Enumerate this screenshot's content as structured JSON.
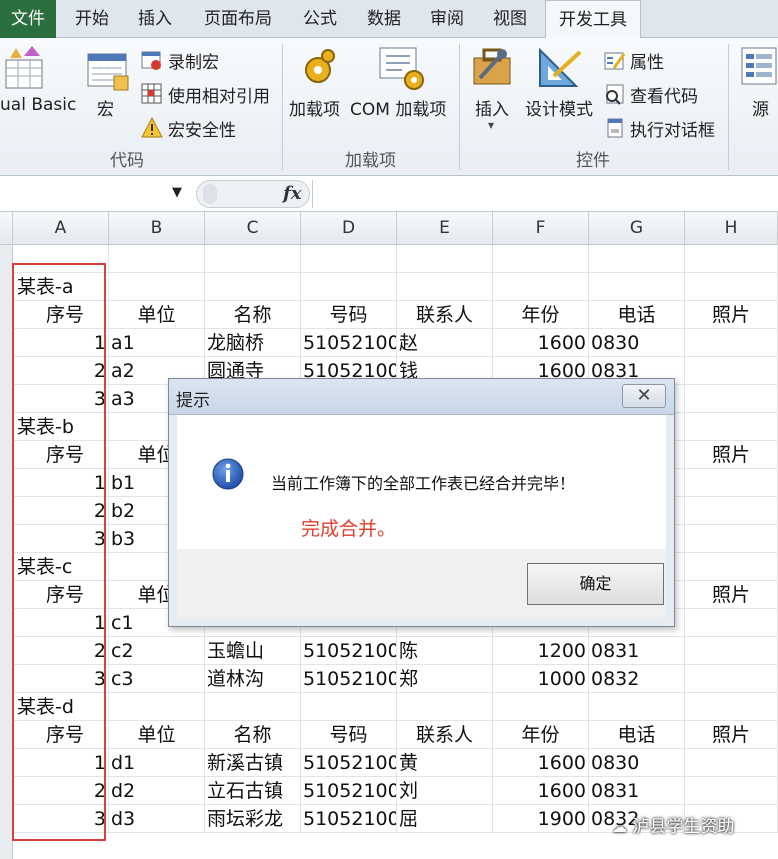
{
  "ribbon": {
    "tabs": [
      "文件",
      "开始",
      "插入",
      "页面布局",
      "公式",
      "数据",
      "审阅",
      "视图",
      "开发工具"
    ],
    "active_tab": "开发工具",
    "code_group": {
      "visual_basic": "ual Basic",
      "macros": "宏",
      "record_macro": "录制宏",
      "use_relative": "使用相对引用",
      "macro_security": "宏安全性",
      "label": "代码"
    },
    "addins_group": {
      "addins": "加载项",
      "com_addins": "COM 加载项",
      "label": "加载项"
    },
    "controls_group": {
      "insert": "插入",
      "design_mode": "设计模式",
      "properties": "属性",
      "view_code": "查看代码",
      "run_dialog": "执行对话框",
      "label": "控件"
    },
    "source": "源"
  },
  "formula_bar": {
    "fx": "fx"
  },
  "grid": {
    "columns": [
      "A",
      "B",
      "C",
      "D",
      "E",
      "F",
      "G",
      "H"
    ],
    "rows": [
      [
        "",
        "",
        "",
        "",
        "",
        "",
        "",
        ""
      ],
      [
        "某表-a",
        "",
        "",
        "",
        "",
        "",
        "",
        ""
      ],
      [
        "序号",
        "单位",
        "名称",
        "号码",
        "联系人",
        "年份",
        "电话",
        "照片"
      ],
      [
        "1",
        "a1",
        "龙脑桥",
        "51052100(",
        "赵",
        "1600",
        "0830",
        ""
      ],
      [
        "2",
        "a2",
        "圆通寺",
        "51052100(",
        "钱",
        "1600",
        "0831",
        ""
      ],
      [
        "3",
        "a3",
        "",
        "",
        "",
        "",
        "",
        ""
      ],
      [
        "某表-b",
        "",
        "",
        "",
        "",
        "",
        "",
        ""
      ],
      [
        "序号",
        "单位",
        "",
        "",
        "",
        "",
        "",
        "照片"
      ],
      [
        "1",
        "b1",
        "",
        "",
        "",
        "",
        "",
        ""
      ],
      [
        "2",
        "b2",
        "",
        "",
        "",
        "",
        "",
        ""
      ],
      [
        "3",
        "b3",
        "",
        "",
        "",
        "",
        "",
        ""
      ],
      [
        "某表-c",
        "",
        "",
        "",
        "",
        "",
        "",
        ""
      ],
      [
        "序号",
        "单位",
        "",
        "",
        "",
        "",
        "",
        "照片"
      ],
      [
        "1",
        "c1",
        "",
        "",
        "",
        "",
        "",
        ""
      ],
      [
        "2",
        "c2",
        "玉蟾山",
        "51052100(",
        "陈",
        "1200",
        "0831",
        ""
      ],
      [
        "3",
        "c3",
        "道林沟",
        "51052100(",
        "郑",
        "1000",
        "0832",
        ""
      ],
      [
        "某表-d",
        "",
        "",
        "",
        "",
        "",
        "",
        ""
      ],
      [
        "序号",
        "单位",
        "名称",
        "号码",
        "联系人",
        "年份",
        "电话",
        "照片"
      ],
      [
        "1",
        "d1",
        "新溪古镇",
        "51052100(",
        "黄",
        "1600",
        "0830",
        ""
      ],
      [
        "2",
        "d2",
        "立石古镇",
        "51052100(",
        "刘",
        "1600",
        "0831",
        ""
      ],
      [
        "3",
        "d3",
        "雨坛彩龙",
        "51052100(",
        "屈",
        "1900",
        "0832",
        ""
      ]
    ]
  },
  "dialog": {
    "title": "提示",
    "message": "当前工作簿下的全部工作表已经合并完毕！",
    "annotation": "完成合并。",
    "ok_button": "确定"
  },
  "watermark": "泸县学生资助",
  "colors": {
    "file_tab": "#2a6f3d",
    "annotation": "#e0402e",
    "highlight_box": "#d8403c"
  }
}
